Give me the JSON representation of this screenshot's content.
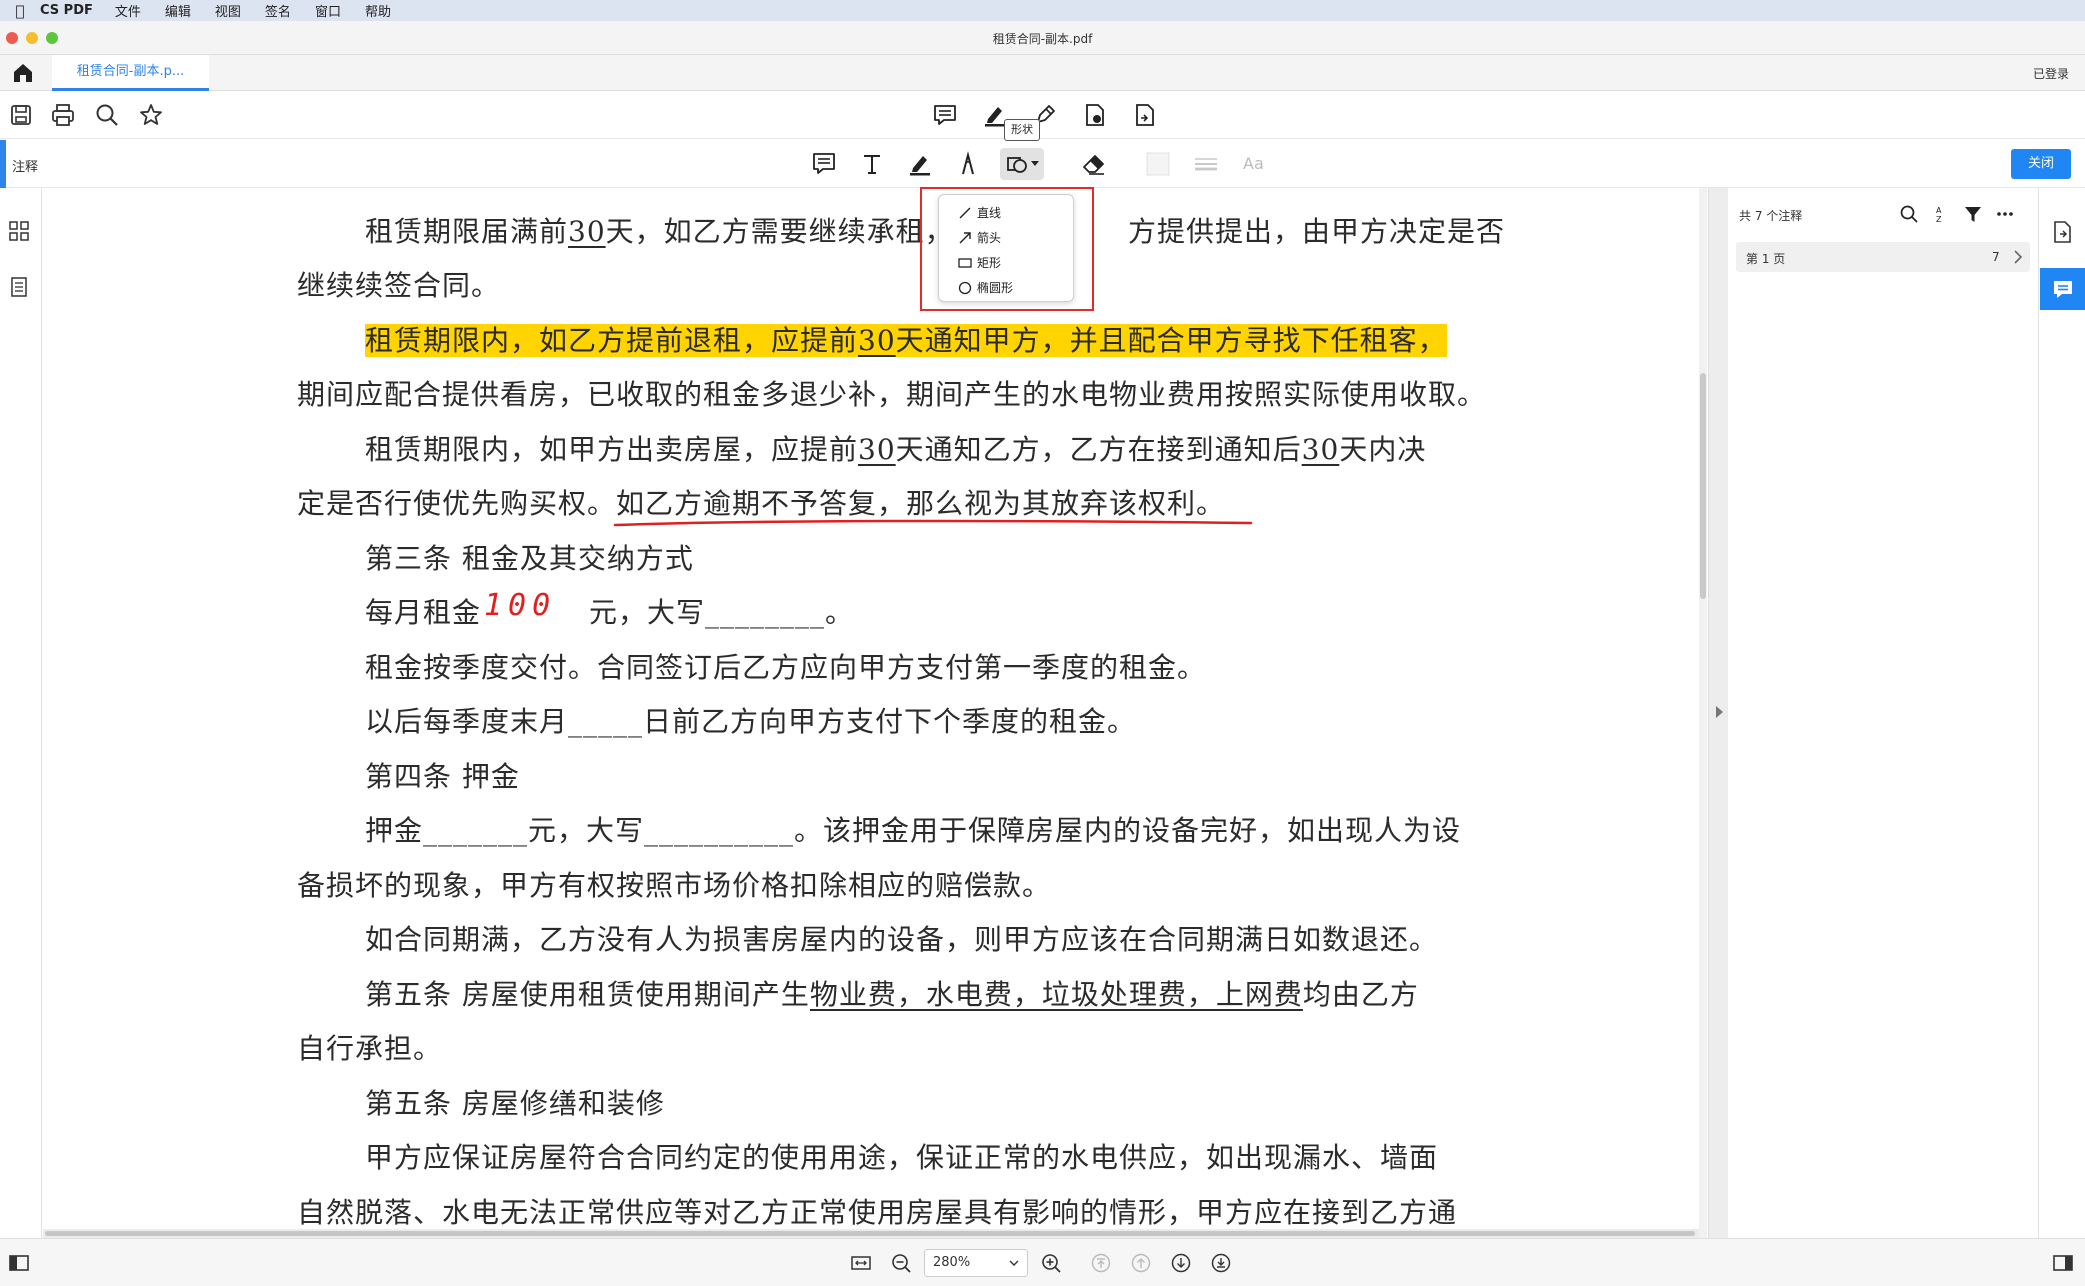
{
  "menubar": {
    "app_name": "CS PDF",
    "items": [
      "文件",
      "编辑",
      "视图",
      "签名",
      "窗口",
      "帮助"
    ]
  },
  "window": {
    "title": "租赁合同-副本.pdf"
  },
  "tabs": {
    "active_tab": "租赁合同-副本.p...",
    "login_status": "已登录"
  },
  "toolbar": {
    "tooltip": "形状",
    "icons": [
      "save-icon",
      "print-icon",
      "search-icon",
      "bookmark-star-icon",
      "comment-icon",
      "highlight-pen-icon",
      "signature-pen-icon",
      "page-settings-icon",
      "export-page-icon"
    ]
  },
  "annotation_bar": {
    "label": "注释",
    "close_label": "关闭",
    "font_label": "Aa",
    "icons": [
      "note-icon",
      "text-icon",
      "highlighter-icon",
      "freehand-pen-icon",
      "shape-icon",
      "eraser-icon",
      "color-swatch-icon",
      "line-weight-icon"
    ]
  },
  "shape_menu": {
    "items": [
      {
        "label": "直线",
        "icon": "line-icon"
      },
      {
        "label": "箭头",
        "icon": "arrow-icon"
      },
      {
        "label": "矩形",
        "icon": "rectangle-icon"
      },
      {
        "label": "椭圆形",
        "icon": "ellipse-icon"
      }
    ]
  },
  "document": {
    "p1_a": "租赁期限届满前",
    "p1_days": "30",
    "p1_b": "天，如乙方需要继续承租，",
    "p1_c": "方提供提出，由甲方决定是否",
    "p1_d": "继续续签合同。",
    "p2_a": "租赁期限内，如乙方提前退租，应提前",
    "p2_days": "30",
    "p2_b": "天通知甲方，并且配合甲方寻找下任租客，",
    "p2_c": "期间应配合提供看房，已收取的租金多退少补，期间产生的水电物业费用按照实际使用收取。",
    "p3_a": "租赁期限内，如甲方出卖房屋，应提前",
    "p3_days1": "30",
    "p3_b": "天通知乙方，乙方在接到通知后",
    "p3_days2": "30",
    "p3_c": "天内决",
    "p3_d": "定是否行使优先购买权。如乙方逾期不予答复，那么视为其放弃该权利。",
    "s3_title": "第三条  租金及其交纳方式",
    "rent_a": "每月租金",
    "rent_handwritten": "100",
    "rent_b": "元，大写________。",
    "rent_c": "租金按季度交付。合同签订后乙方应向甲方支付第一季度的租金。",
    "rent_d": "以后每季度末月_____日前乙方向甲方支付下个季度的租金。",
    "s4_title": "第四条  押金",
    "dep_a": "押金_______元，大写__________。该押金用于保障房屋内的设备完好，如出现人为设",
    "dep_b": "备损坏的现象，甲方有权按照市场价格扣除相应的赔偿款。",
    "dep_c": "如合同期满，乙方没有人为损害房屋内的设备，则甲方应该在合同期满日如数退还。",
    "s5_a": "第五条  房屋使用租赁使用期间产生",
    "s5_fees": "物业费，水电费，垃圾处理费，上网费",
    "s5_b": "均由乙方",
    "s5_c": "自行承担。",
    "s5b_title": "第五条  房屋修缮和装修",
    "rep_a": "甲方应保证房屋符合合同约定的使用用途，保证正常的水电供应，如出现漏水、墙面",
    "rep_b": "自然脱落、水电无法正常供应等对乙方正常使用房屋具有影响的情形，甲方应在接到乙方通"
  },
  "annotation_panel": {
    "count_label": "共 7 个注释",
    "page_row": {
      "label": "第 1 页",
      "count": "7"
    }
  },
  "bottombar": {
    "zoom": "280%"
  },
  "colors": {
    "accent": "#1f86f3",
    "highlight": "#ffd400",
    "annotation_red": "#e02020"
  }
}
